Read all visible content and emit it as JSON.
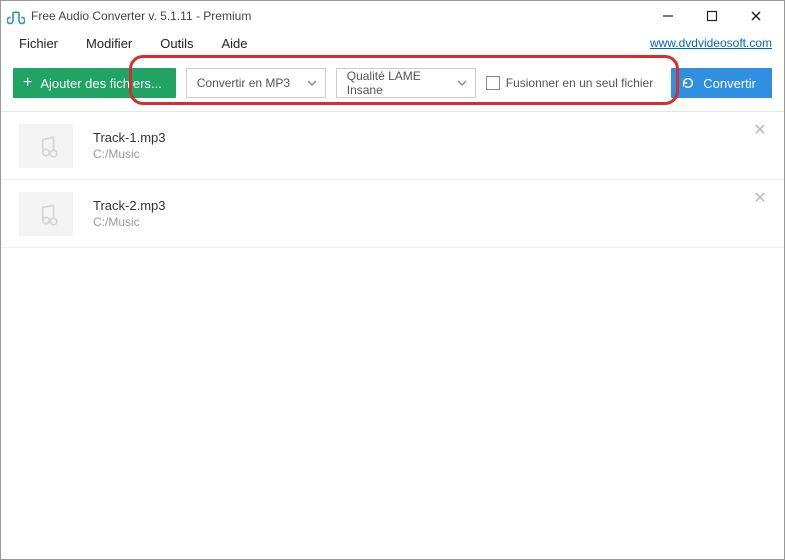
{
  "window": {
    "title": "Free Audio Converter v. 5.1.11 - Premium"
  },
  "menu": {
    "file": "Fichier",
    "edit": "Modifier",
    "tools": "Outils",
    "help": "Aide",
    "link": "www.dvdvideosoft.com"
  },
  "toolbar": {
    "add_label": "Ajouter des fichiers...",
    "format_label": "Convertir en MP3",
    "quality_label": "Qualité LAME Insane",
    "merge_label": "Fusionner en un seul fichier",
    "convert_label": "Convertir"
  },
  "files": [
    {
      "name": "Track-1.mp3",
      "path": "C:/Music"
    },
    {
      "name": "Track-2.mp3",
      "path": "C:/Music"
    }
  ]
}
